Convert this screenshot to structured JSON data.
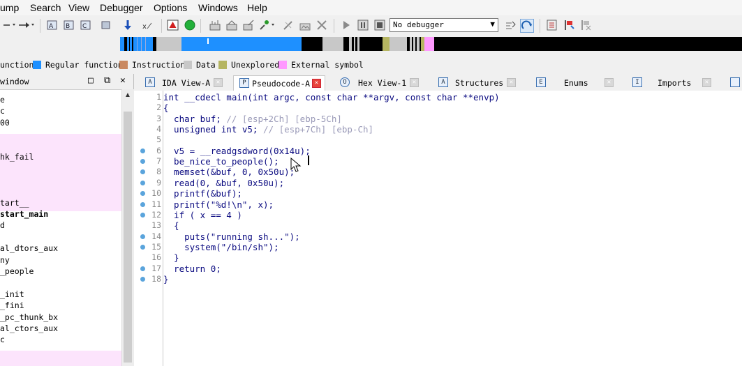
{
  "menu": [
    "ump",
    "Search",
    "View",
    "Debugger",
    "Options",
    "Windows",
    "Help"
  ],
  "toolbar": {
    "debugger_select": "No debugger",
    "icons": [
      "back-arrow-icon",
      "forward-arrow-icon",
      "disasm-a-icon",
      "disasm-b-icon",
      "disasm-c-icon",
      "binary-icon",
      "jump-down-icon",
      "search-icon",
      "stop-icon",
      "run-icon",
      "graph-icon",
      "graph2-icon",
      "script-icon",
      "breakpoint-icon",
      "patch-icon",
      "picture-icon",
      "close-icon",
      "play-icon",
      "pause-icon",
      "stop-square-icon",
      "step-icon",
      "refresh-icon",
      "list-icon",
      "pin-icon",
      "tool-icon"
    ]
  },
  "legend": [
    {
      "label": "unction",
      "color": "#1e90ff"
    },
    {
      "label": "Regular function",
      "color": "#c98860"
    },
    {
      "label": "Instruction",
      "color": "#c8c8c8"
    },
    {
      "label": "Data",
      "color": "#b5b561"
    },
    {
      "label": "Unexplored",
      "color": "#ff99ff"
    },
    {
      "label": "External symbol",
      "color": ""
    }
  ],
  "functions_panel": {
    "title": "window",
    "items": [
      "e",
      "c",
      "00",
      "",
      "",
      "hk_fail",
      "",
      "",
      "",
      "tart__",
      "start_main",
      "d",
      "",
      "al_dtors_aux",
      "ny",
      "_people",
      "",
      "_init",
      "_fini",
      "_pc_thunk_bx",
      "al_ctors_aux",
      "c"
    ]
  },
  "tabs": [
    {
      "label": "IDA View-A",
      "icon": "A"
    },
    {
      "label": "Pseudocode-A",
      "icon": "P"
    },
    {
      "label": "Hex View-1",
      "icon": "O"
    },
    {
      "label": "Structures",
      "icon": "A"
    },
    {
      "label": "Enums",
      "icon": "E"
    },
    {
      "label": "Imports",
      "icon": "I"
    }
  ],
  "code": [
    {
      "n": "1",
      "t": "int __cdecl main(int argc, const char **argv, const char **envp)",
      "c": "",
      "dot": false
    },
    {
      "n": "2",
      "t": "{",
      "c": "",
      "dot": false
    },
    {
      "n": "3",
      "t": "  char buf; ",
      "c": "// [esp+2Ch] [ebp-5Ch]",
      "dot": false
    },
    {
      "n": "4",
      "t": "  unsigned int v5; ",
      "c": "// [esp+7Ch] [ebp-Ch]",
      "dot": false
    },
    {
      "n": "5",
      "t": "",
      "c": "",
      "dot": false
    },
    {
      "n": "6",
      "t": "  v5 = __readgsdword(0x14u);",
      "c": "",
      "dot": true
    },
    {
      "n": "7",
      "t": "  be_nice_to_people();",
      "c": "",
      "dot": true
    },
    {
      "n": "8",
      "t": "  memset(&buf, 0, 0x50u);",
      "c": "",
      "dot": true
    },
    {
      "n": "9",
      "t": "  read(0, &buf, 0x50u);",
      "c": "",
      "dot": true
    },
    {
      "n": "10",
      "t": "  printf(&buf);",
      "c": "",
      "dot": true
    },
    {
      "n": "11",
      "t": "  printf(\"%d!\\n\", x);",
      "c": "",
      "dot": true
    },
    {
      "n": "12",
      "t": "  if ( x == 4 )",
      "c": "",
      "dot": true
    },
    {
      "n": "13",
      "t": "  {",
      "c": "",
      "dot": false
    },
    {
      "n": "14",
      "t": "    puts(\"running sh...\");",
      "c": "",
      "dot": true
    },
    {
      "n": "15",
      "t": "    system(\"/bin/sh\");",
      "c": "",
      "dot": true
    },
    {
      "n": "16",
      "t": "  }",
      "c": "",
      "dot": false
    },
    {
      "n": "17",
      "t": "  return 0;",
      "c": "",
      "dot": true
    },
    {
      "n": "18",
      "t": "}",
      "c": "",
      "dot": true
    }
  ]
}
